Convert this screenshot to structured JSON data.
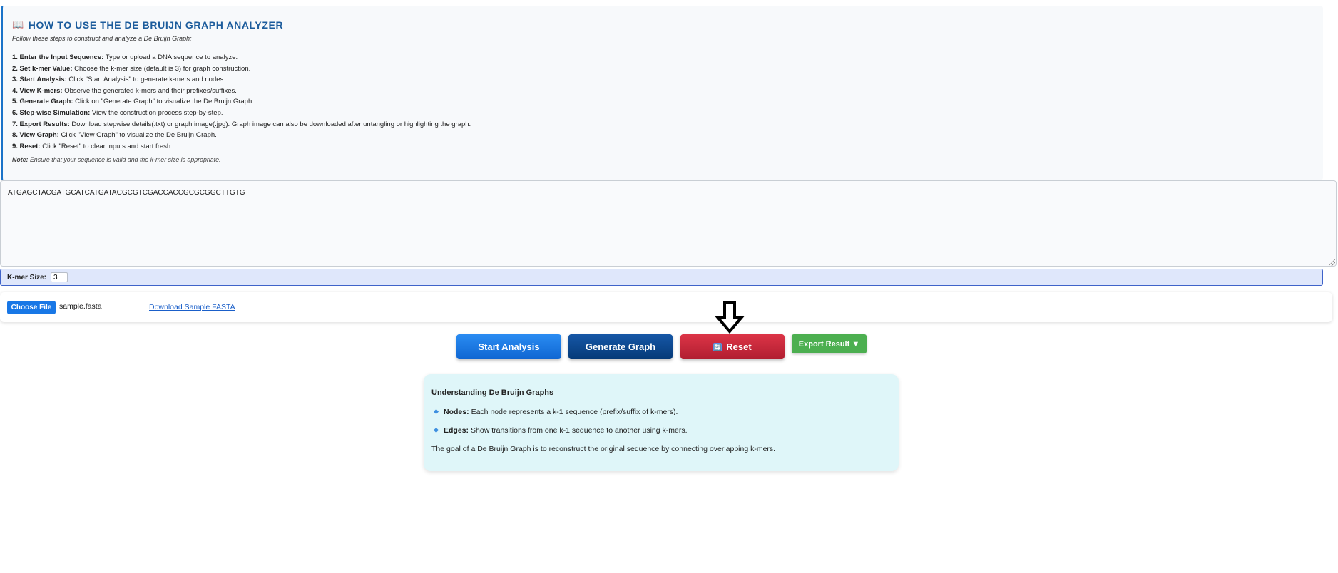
{
  "instructions": {
    "title": "HOW TO USE THE DE BRUIJN GRAPH ANALYZER",
    "intro": "Follow these steps to construct and analyze a De Bruijn Graph:",
    "steps": [
      {
        "label": "1. Enter the Input Sequence:",
        "text": "Type or upload a DNA sequence to analyze."
      },
      {
        "label": "2. Set k-mer Value:",
        "text": "Choose the k-mer size (default is 3) for graph construction."
      },
      {
        "label": "3. Start Analysis:",
        "text": "Click \"Start Analysis\" to generate k-mers and nodes."
      },
      {
        "label": "4. View K-mers:",
        "text": "Observe the generated k-mers and their prefixes/suffixes."
      },
      {
        "label": "5. Generate Graph:",
        "text": "Click on \"Generate Graph\" to visualize the De Bruijn Graph."
      },
      {
        "label": "6. Step-wise Simulation:",
        "text": "View the construction process step-by-step."
      },
      {
        "label": "7. Export Results:",
        "text": "Download stepwise details(.txt) or graph image(.jpg). Graph image can also be downloaded after untangling or highlighting the graph."
      },
      {
        "label": "8. View Graph:",
        "text": "Click \"View Graph\" to visualize the De Bruijn Graph."
      },
      {
        "label": "9. Reset:",
        "text": "Click \"Reset\" to clear inputs and start fresh."
      }
    ],
    "note_label": "Note:",
    "note_text": "Ensure that your sequence is valid and the k-mer size is appropriate."
  },
  "sequence": {
    "value": "ATGAGCTACGATGCATCATGATACGCGTCGACCACCGCGCGGCTTGTG"
  },
  "kmer": {
    "label": "K-mer Size:",
    "value": "3"
  },
  "file": {
    "choose_label": "Choose File",
    "file_name": "sample.fasta",
    "download_label": "Download Sample FASTA"
  },
  "buttons": {
    "start": "Start Analysis",
    "generate": "Generate Graph",
    "reset": "Reset",
    "export": "Export Result ▼"
  },
  "info": {
    "title": "Understanding De Bruijn Graphs",
    "nodes_label": "Nodes:",
    "nodes_text": "Each node represents a k-1 sequence (prefix/suffix of k-mers).",
    "edges_label": "Edges:",
    "edges_text": "Show transitions from one k-1 sequence to another using k-mers.",
    "goal": "The goal of a De Bruijn Graph is to reconstruct the original sequence by connecting overlapping k-mers."
  },
  "colors": {
    "accent_blue": "#1877e6",
    "reset_red": "#c82434",
    "export_green": "#4caf50",
    "info_bg": "#dff6f9"
  }
}
